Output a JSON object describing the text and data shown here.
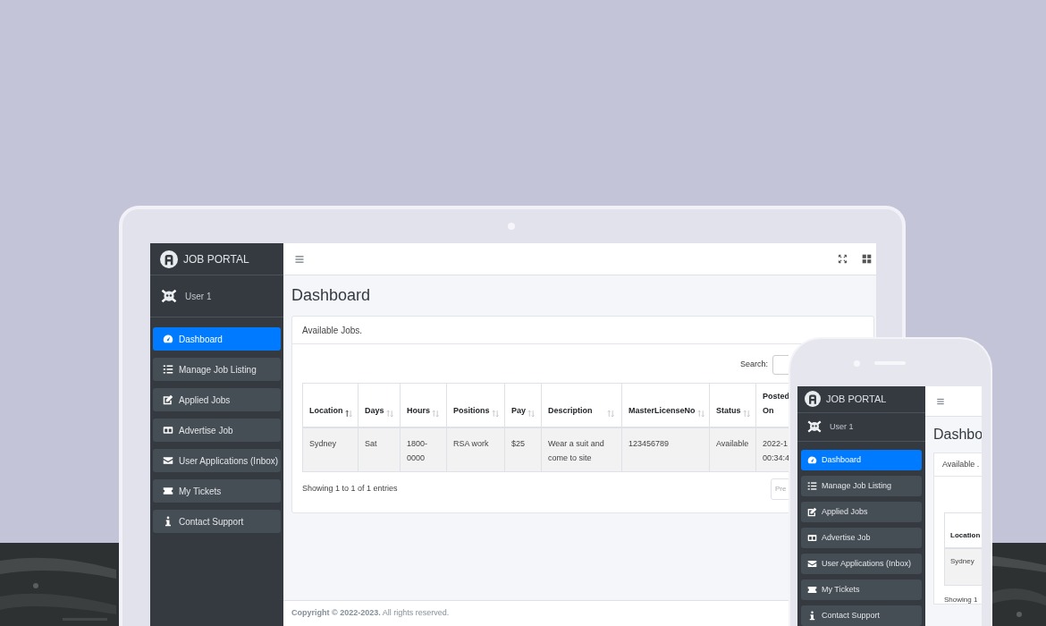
{
  "laptop": {
    "brand": "JOB PORTAL",
    "user": "User 1",
    "nav": [
      {
        "label": "Dashboard",
        "selected": true
      },
      {
        "label": "Manage Job Listing",
        "selected": false
      },
      {
        "label": "Applied Jobs",
        "selected": false
      },
      {
        "label": "Advertise Job",
        "selected": false
      },
      {
        "label": "User Applications (Inbox)",
        "selected": false
      },
      {
        "label": "My Tickets",
        "selected": false
      },
      {
        "label": "Contact Support",
        "selected": false
      }
    ],
    "page_title": "Dashboard",
    "card_title": "Available Jobs.",
    "search_label": "Search:",
    "table": {
      "columns": [
        {
          "label": "Location",
          "sorted": true
        },
        {
          "label": "Days",
          "sorted": false
        },
        {
          "label": "Hours",
          "sorted": false
        },
        {
          "label": "Positions",
          "sorted": false
        },
        {
          "label": "Pay",
          "sorted": false
        },
        {
          "label": "Description",
          "sorted": false
        },
        {
          "label": "MasterLicenseNo",
          "sorted": false
        },
        {
          "label": "Status",
          "sorted": false
        },
        {
          "label": "Posted On"
        }
      ],
      "rows": [
        [
          "Sydney",
          "Sat",
          "1800-0000",
          "RSA work",
          "$25",
          "Wear a suit and come to site",
          "123456789",
          "Available",
          "2022-1 00:34:4"
        ]
      ]
    },
    "info": "Showing 1 to 1 of 1 entries",
    "pager": "Pre",
    "footer": "**Copyright © 2022-2023.** All rights reserved."
  },
  "phone": {
    "brand": "JOB PORTAL",
    "user": "User 1",
    "nav": [
      {
        "label": "Dashboard",
        "selected": true
      },
      {
        "label": "Manage Job Listing",
        "selected": false
      },
      {
        "label": "Applied Jobs",
        "selected": false
      },
      {
        "label": "Advertise Job",
        "selected": false
      },
      {
        "label": "User Applications (Inbox)",
        "selected": false
      },
      {
        "label": "My Tickets",
        "selected": false
      },
      {
        "label": "Contact Support",
        "selected": false
      }
    ],
    "page_title": "Dashbo",
    "card_title": "Available .",
    "column": "Location",
    "cell": "Sydney",
    "info": "Showing 1"
  }
}
